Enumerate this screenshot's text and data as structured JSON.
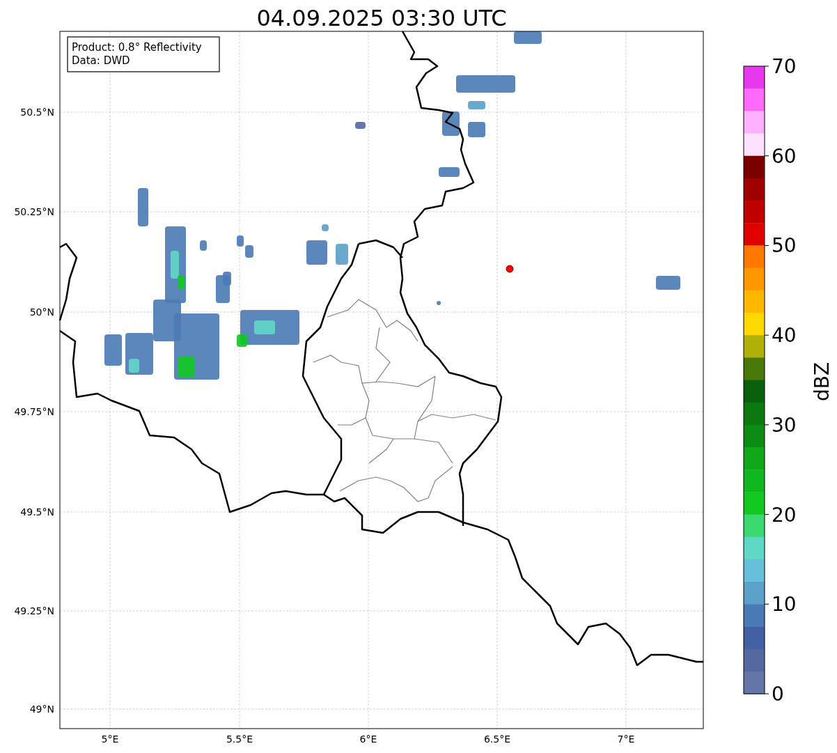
{
  "title": "04.09.2025 03:30 UTC",
  "info_box": {
    "lines": [
      "Product: 0.8° Reflectivity",
      "Data: DWD"
    ]
  },
  "map": {
    "xtick_labels": [
      "5°E",
      "5.5°E",
      "6°E",
      "6.5°E",
      "7°E"
    ],
    "ytick_labels": [
      "50.5°N",
      "50.25°N",
      "50°N",
      "49.75°N",
      "49.5°N",
      "49.25°N",
      "49°N"
    ]
  },
  "colorbar": {
    "label": "dBZ",
    "tick_labels": [
      "70",
      "60",
      "50",
      "40",
      "30",
      "20",
      "10",
      "0"
    ],
    "segments": [
      {
        "color": "#e838f0"
      },
      {
        "color": "#ff68f8"
      },
      {
        "color": "#ffb0ff"
      },
      {
        "color": "#ffe0ff"
      },
      {
        "color": "#780000"
      },
      {
        "color": "#a00000"
      },
      {
        "color": "#c00000"
      },
      {
        "color": "#e00000"
      },
      {
        "color": "#ff7800"
      },
      {
        "color": "#ff9800"
      },
      {
        "color": "#ffb800"
      },
      {
        "color": "#ffd800"
      },
      {
        "color": "#b0b008"
      },
      {
        "color": "#487808"
      },
      {
        "color": "#08600c"
      },
      {
        "color": "#0c7810"
      },
      {
        "color": "#0c8c14"
      },
      {
        "color": "#10a818"
      },
      {
        "color": "#10b820"
      },
      {
        "color": "#10c820"
      },
      {
        "color": "#3cd870"
      },
      {
        "color": "#60d8c8"
      },
      {
        "color": "#66c0dc"
      },
      {
        "color": "#5aa0c8"
      },
      {
        "color": "#4a7ab5"
      },
      {
        "color": "#4460a4"
      },
      {
        "color": "#5468a0"
      },
      {
        "color": "#6475a8"
      }
    ]
  }
}
